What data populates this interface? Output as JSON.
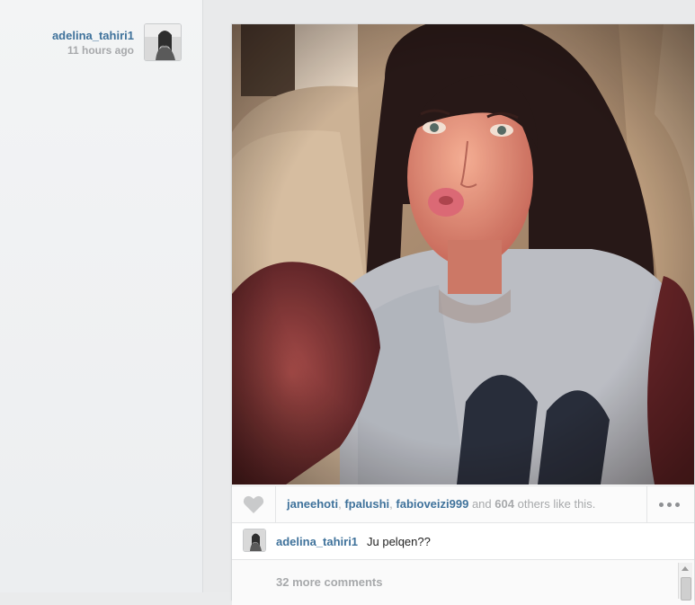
{
  "owner": {
    "username": "adelina_tahiri1",
    "time_ago": "11 hours ago"
  },
  "post": {
    "photo_alt": "selfie",
    "likes": {
      "likers": [
        "janeehoti",
        "fpalushi",
        "fabioveizi999"
      ],
      "separator": ", ",
      "and_word": "and",
      "others_count": "604",
      "suffix": "others like this."
    },
    "caption": {
      "username": "adelina_tahiri1",
      "text": "Ju pelqen??"
    },
    "more_comments_label": "32 more comments"
  },
  "icons": {
    "like": "heart-icon",
    "options": "more-options-icon"
  },
  "colors": {
    "link_blue": "#3f729b",
    "muted_gray": "#a7a9ab"
  }
}
